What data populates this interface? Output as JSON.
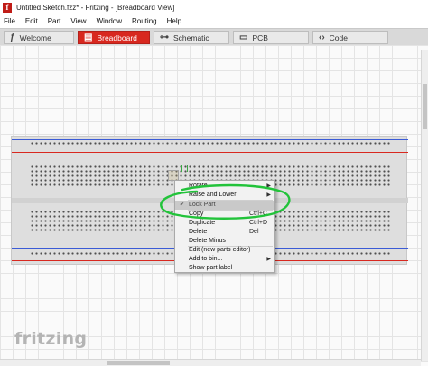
{
  "window": {
    "title": "Untitled Sketch.fzz* - Fritzing - [Breadboard View]",
    "logo_letter": "f"
  },
  "menubar": {
    "items": [
      "File",
      "Edit",
      "Part",
      "View",
      "Window",
      "Routing",
      "Help"
    ]
  },
  "tabs": [
    {
      "label": "Welcome",
      "icon": "ƒ",
      "icon_name": "fritzing-icon",
      "active": false
    },
    {
      "label": "Breadboard",
      "icon": "▤",
      "icon_name": "breadboard-icon",
      "active": true
    },
    {
      "label": "Schematic",
      "icon": "⊶",
      "icon_name": "schematic-icon",
      "active": false
    },
    {
      "label": "PCB",
      "icon": "▭",
      "icon_name": "pcb-icon",
      "active": false
    },
    {
      "label": "Code",
      "icon": "‹›",
      "icon_name": "code-icon",
      "active": false
    }
  ],
  "context_menu": {
    "items": [
      {
        "label": "Rotate",
        "shortcut": "",
        "submenu": true
      },
      {
        "label": "Raise and Lower",
        "shortcut": "",
        "submenu": true
      },
      {
        "label": "Lock Part",
        "shortcut": "",
        "submenu": false,
        "highlighted": true,
        "checked": true
      },
      {
        "label": "Copy",
        "shortcut": "Ctrl+C",
        "submenu": false
      },
      {
        "label": "Duplicate",
        "shortcut": "Ctrl+D",
        "submenu": false
      },
      {
        "label": "Delete",
        "shortcut": "Del",
        "submenu": false
      },
      {
        "label": "Delete Minus",
        "shortcut": "",
        "submenu": false
      },
      {
        "label": "Edit (new parts editor)",
        "shortcut": "",
        "submenu": false
      },
      {
        "label": "Add to bin...",
        "shortcut": "",
        "submenu": true
      },
      {
        "label": "Show part label",
        "shortcut": "",
        "submenu": false
      }
    ],
    "check_glyph": "✔",
    "submenu_glyph": "▶"
  },
  "watermark": "fritzing",
  "colors": {
    "accent": "#d8281f",
    "rail_blue": "#3b5bd6",
    "rail_red": "#d8281f",
    "annotation": "#22c33a"
  }
}
